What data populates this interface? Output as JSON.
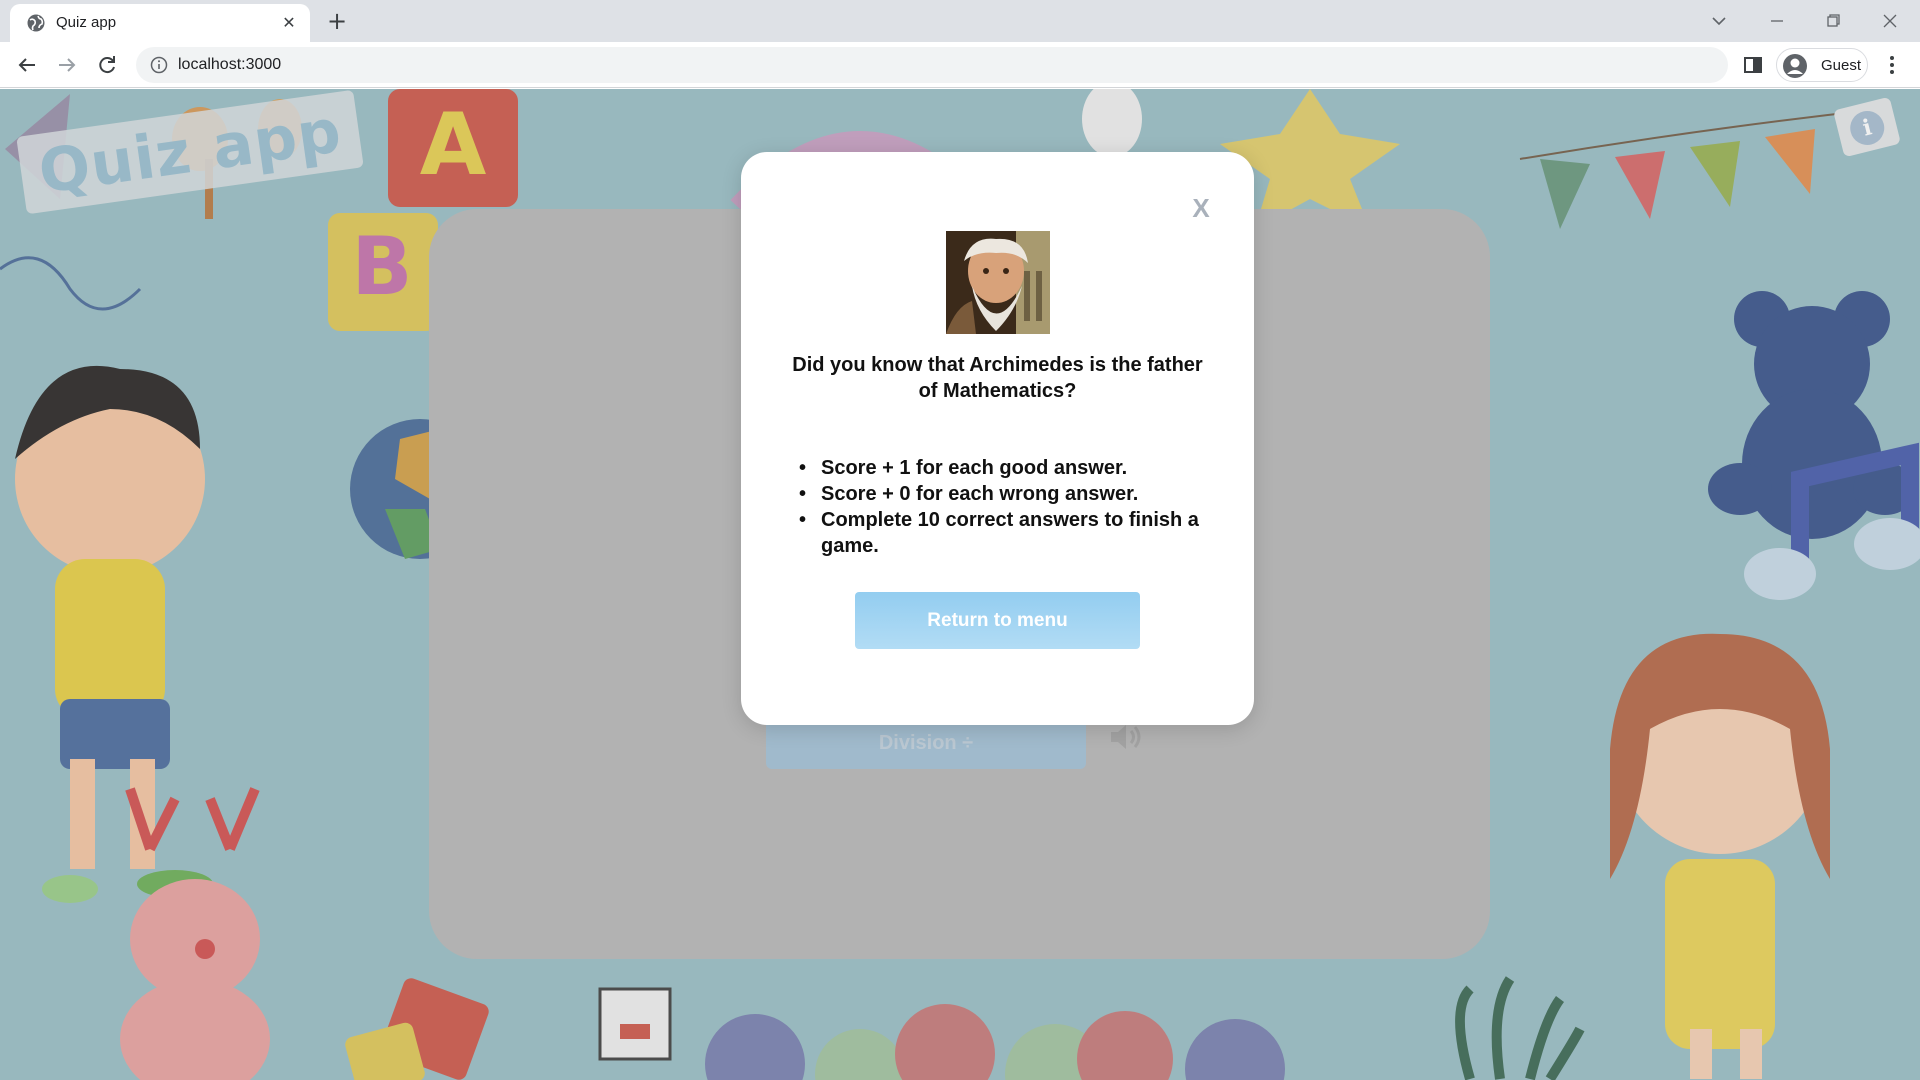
{
  "browser": {
    "tab_title": "Quiz app",
    "url": "localhost:3000",
    "profile_label": "Guest"
  },
  "page": {
    "brand": "Quiz app",
    "division_button": "Division ÷",
    "info_icon": "info-icon",
    "sound_icon": "speaker-icon"
  },
  "modal": {
    "close_label": "X",
    "portrait": "archimedes-portrait",
    "fact": "Did you know that Archimedes is the father of Mathematics?",
    "rules": [
      "Score + 1 for each good answer.",
      "Score + 0 for each wrong answer.",
      "Complete 10 correct answers to finish a game."
    ],
    "return_button": "Return to menu"
  },
  "colors": {
    "page_background": "#9bc0c6",
    "button_gradient_top": "#93cdf0",
    "button_gradient_bottom": "#b2dcf5"
  }
}
